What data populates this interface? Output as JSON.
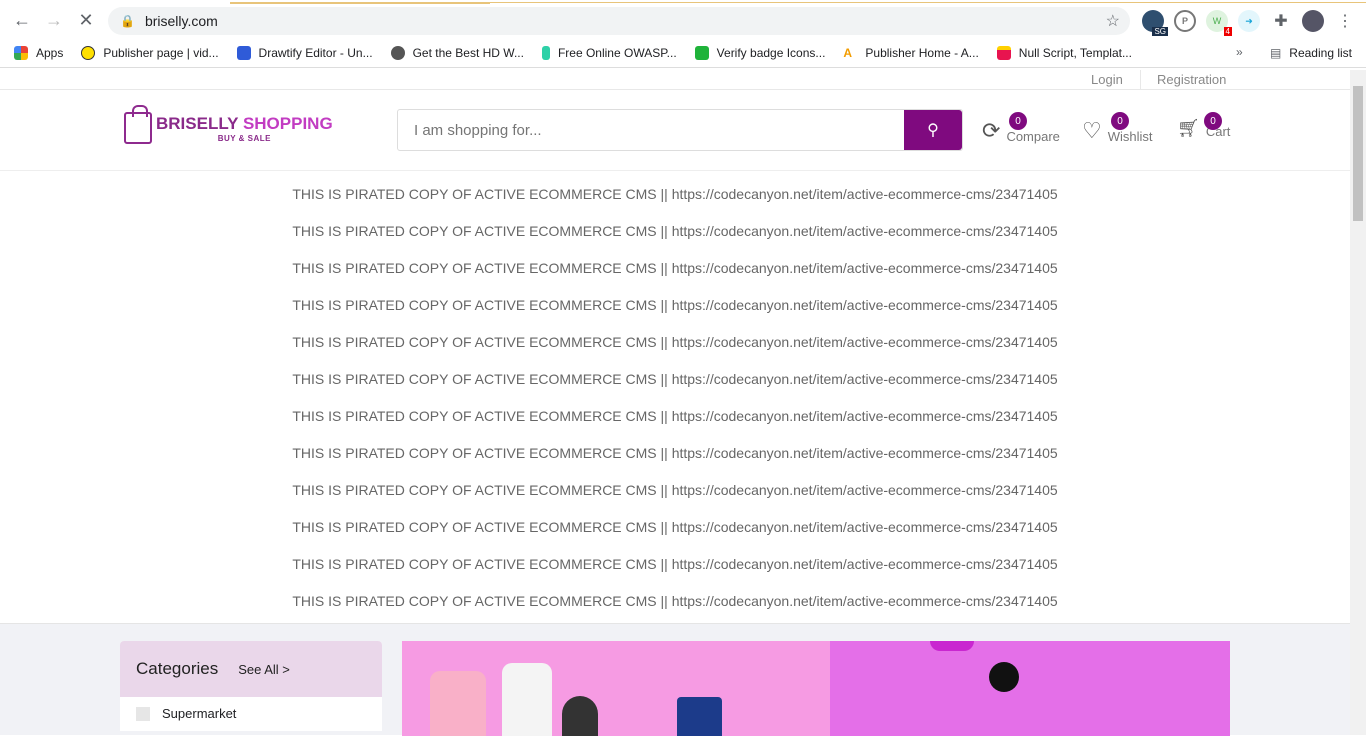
{
  "browser": {
    "url": "briselly.com",
    "bookmarks": [
      "Apps",
      "Publisher page | vid...",
      "Drawtify Editor - Un...",
      "Get the Best HD W...",
      "Free Online OWASP...",
      "Verify badge Icons...",
      "Publisher Home - A...",
      "Null Script, Templat..."
    ],
    "reading_list": "Reading list",
    "ext_badges": {
      "sg": "SG",
      "whatsapp": "4"
    }
  },
  "topbar": {
    "login": "Login",
    "registration": "Registration"
  },
  "logo": {
    "main": "BRISELLY",
    "accent": "SHOPPING",
    "tagline": "BUY & SALE"
  },
  "search": {
    "placeholder": "I am shopping for..."
  },
  "header": {
    "compare": {
      "label": "Compare",
      "count": "0"
    },
    "wishlist": {
      "label": "Wishlist",
      "count": "0"
    },
    "cart": {
      "label": "Cart",
      "count": "0"
    }
  },
  "notices": [
    "THIS IS PIRATED COPY OF ACTIVE ECOMMERCE CMS || https://codecanyon.net/item/active-ecommerce-cms/23471405",
    "THIS IS PIRATED COPY OF ACTIVE ECOMMERCE CMS || https://codecanyon.net/item/active-ecommerce-cms/23471405",
    "THIS IS PIRATED COPY OF ACTIVE ECOMMERCE CMS || https://codecanyon.net/item/active-ecommerce-cms/23471405",
    "THIS IS PIRATED COPY OF ACTIVE ECOMMERCE CMS || https://codecanyon.net/item/active-ecommerce-cms/23471405",
    "THIS IS PIRATED COPY OF ACTIVE ECOMMERCE CMS || https://codecanyon.net/item/active-ecommerce-cms/23471405",
    "THIS IS PIRATED COPY OF ACTIVE ECOMMERCE CMS || https://codecanyon.net/item/active-ecommerce-cms/23471405",
    "THIS IS PIRATED COPY OF ACTIVE ECOMMERCE CMS || https://codecanyon.net/item/active-ecommerce-cms/23471405",
    "THIS IS PIRATED COPY OF ACTIVE ECOMMERCE CMS || https://codecanyon.net/item/active-ecommerce-cms/23471405",
    "THIS IS PIRATED COPY OF ACTIVE ECOMMERCE CMS || https://codecanyon.net/item/active-ecommerce-cms/23471405",
    "THIS IS PIRATED COPY OF ACTIVE ECOMMERCE CMS || https://codecanyon.net/item/active-ecommerce-cms/23471405",
    "THIS IS PIRATED COPY OF ACTIVE ECOMMERCE CMS || https://codecanyon.net/item/active-ecommerce-cms/23471405",
    "THIS IS PIRATED COPY OF ACTIVE ECOMMERCE CMS || https://codecanyon.net/item/active-ecommerce-cms/23471405"
  ],
  "categories": {
    "title": "Categories",
    "see_all": "See All >",
    "items": [
      "Supermarket"
    ]
  },
  "colors": {
    "brand": "#7f0a7f",
    "cat_header": "#ead7ea"
  }
}
